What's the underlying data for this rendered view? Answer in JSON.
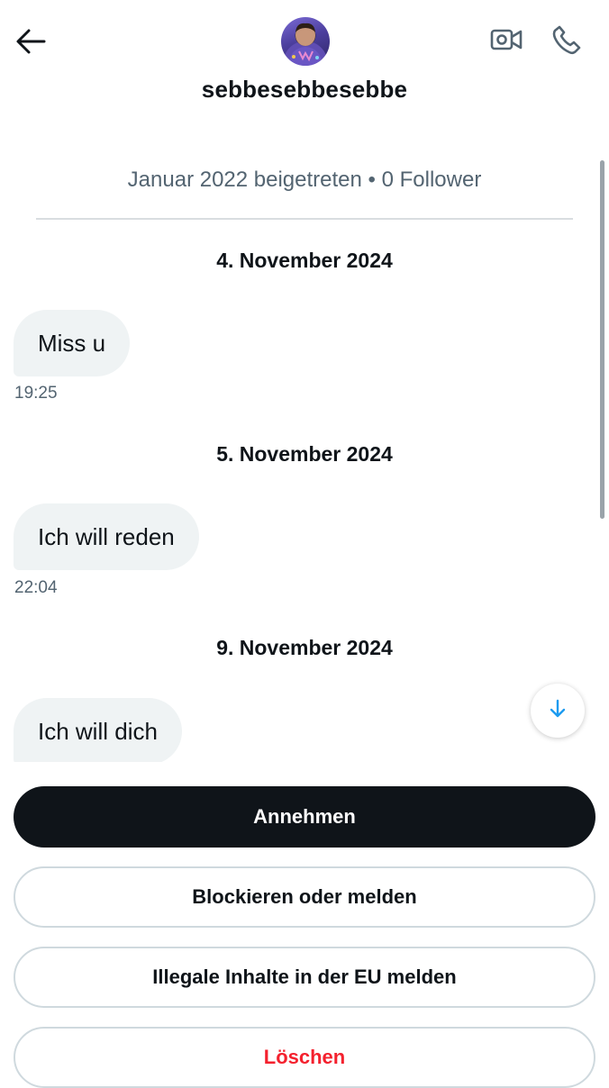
{
  "header": {
    "username": "sebbesebbesebbe",
    "back_icon": "arrow-left-icon",
    "video_icon": "video-camera-icon",
    "phone_icon": "phone-icon"
  },
  "profile": {
    "info": "Januar 2022 beigetreten • 0 Follower"
  },
  "messages": [
    {
      "date": "4. November 2024",
      "text": "Miss u",
      "time": "19:25"
    },
    {
      "date": "5. November 2024",
      "text": "Ich will reden",
      "time": "22:04"
    },
    {
      "date": "9. November 2024",
      "text": "Ich will dich"
    }
  ],
  "actions": {
    "accept": "Annehmen",
    "block_report": "Blockieren oder melden",
    "report_eu": "Illegale Inhalte in der EU melden",
    "delete": "Löschen"
  },
  "colors": {
    "accent_blue": "#1d9bf0",
    "danger_red": "#f4212e",
    "primary_dark": "#0f1419",
    "bubble_bg": "#eff3f4",
    "secondary_text": "#536471"
  }
}
